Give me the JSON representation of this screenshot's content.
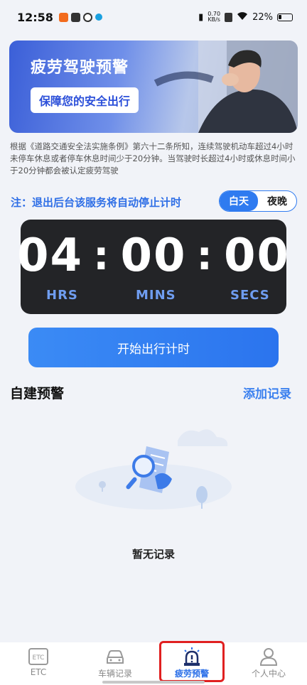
{
  "status_bar": {
    "time": "12:58",
    "net_speed_value": "0.70",
    "net_speed_unit": "KB/s",
    "battery": "22%"
  },
  "banner": {
    "title": "疲劳驾驶预警",
    "subtitle": "保障您的安全出行"
  },
  "description": "根据《道路交通安全法实施条例》第六十二条所知，连续驾驶机动车超过4小时未停车休息或者停车休息时间少于20分钟。当驾驶时长超过4小时或休息时间小于20分钟都会被认定疲劳驾驶",
  "notice": "注：退出后台该服务将自动停止计时",
  "mode_toggle": {
    "day": "白天",
    "night": "夜晚",
    "selected": "白天"
  },
  "timer": {
    "hours": "04",
    "minutes": "00",
    "seconds": "00",
    "separator": ":",
    "hours_label": "HRS",
    "minutes_label": "MINS",
    "seconds_label": "SECS"
  },
  "start_button": "开始出行计时",
  "custom_alerts": {
    "title": "自建预警",
    "add_label": "添加记录",
    "empty_text": "暂无记录"
  },
  "tabbar": {
    "items": [
      {
        "label": "ETC",
        "icon": "etc-icon"
      },
      {
        "label": "车辆记录",
        "icon": "car-icon"
      },
      {
        "label": "疲劳预警",
        "icon": "alarm-light-icon"
      },
      {
        "label": "个人中心",
        "icon": "person-icon"
      }
    ],
    "active": "疲劳预警"
  },
  "colors": {
    "accent": "#2f7bf0",
    "timer_bg": "#232427",
    "timer_label": "#6f9df0",
    "highlight": "#e02020"
  }
}
